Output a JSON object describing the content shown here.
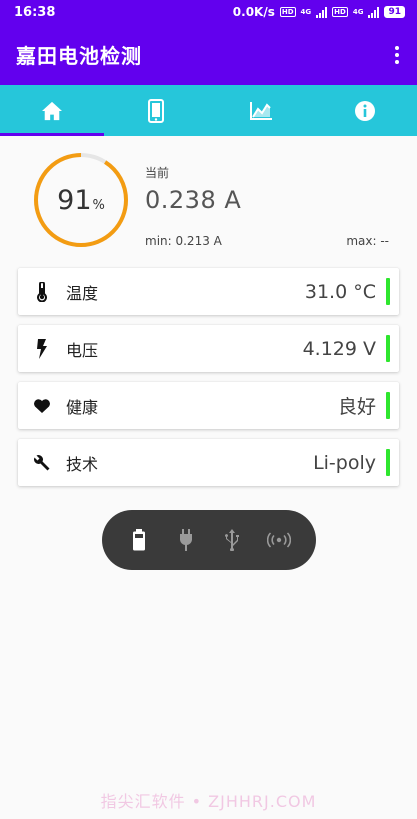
{
  "status_bar": {
    "time": "16:38",
    "network_speed": "0.0K/s",
    "hd_label": "HD",
    "net_type": "4G",
    "battery_level": "91"
  },
  "app_bar": {
    "title": "嘉田电池检测"
  },
  "tabs": [
    {
      "name": "home",
      "icon": "home-icon",
      "active": true
    },
    {
      "name": "device",
      "icon": "phone-icon",
      "active": false
    },
    {
      "name": "chart",
      "icon": "chart-icon",
      "active": false
    },
    {
      "name": "info",
      "icon": "info-icon",
      "active": false
    }
  ],
  "gauge": {
    "value": "91",
    "unit": "%",
    "fraction": 0.91
  },
  "current": {
    "label": "当前",
    "value": "0.238 A",
    "min": "min: 0.213 A",
    "max": "max: --"
  },
  "cards": [
    {
      "icon": "thermometer-icon",
      "label": "温度",
      "value": "31.0 °C"
    },
    {
      "icon": "lightning-icon",
      "label": "电压",
      "value": "4.129 V"
    },
    {
      "icon": "heart-icon",
      "label": "健康",
      "value": "良好"
    },
    {
      "icon": "wrench-icon",
      "label": "技术",
      "value": "Li-poly"
    }
  ],
  "power_sources": [
    {
      "icon": "battery-icon",
      "active": true
    },
    {
      "icon": "ac-plug-icon",
      "active": false
    },
    {
      "icon": "usb-icon",
      "active": false
    },
    {
      "icon": "wireless-icon",
      "active": false
    }
  ],
  "watermark": "指尖汇软件 • ZJHHRJ.COM",
  "colors": {
    "primary": "#6200ee",
    "tab_bar": "#26c6da",
    "gauge_arc": "#f39c12",
    "gauge_track": "#e6e6e6",
    "status_ok": "#2ee62e",
    "pill_bg": "#3a3a3a"
  }
}
